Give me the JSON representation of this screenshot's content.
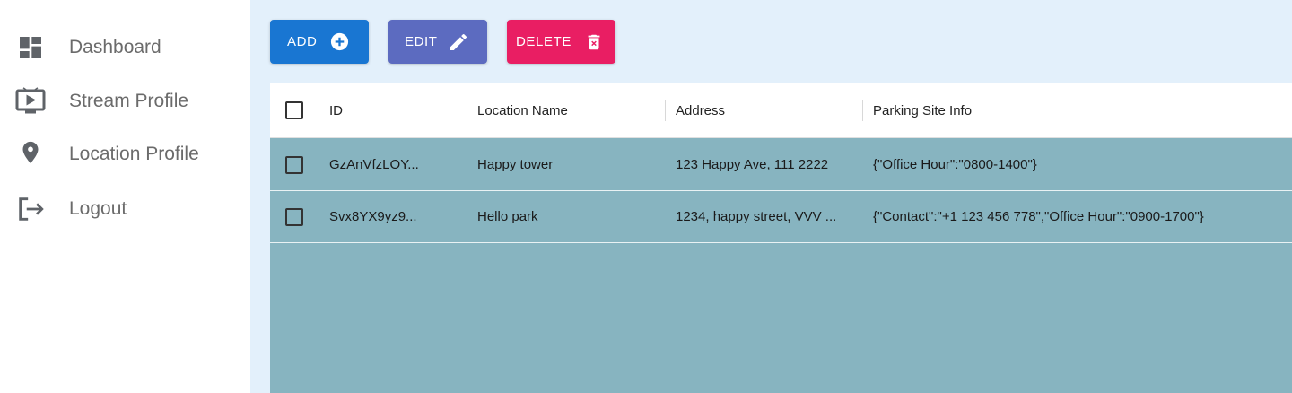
{
  "sidebar": {
    "items": [
      {
        "label": "Dashboard",
        "icon": "dashboard-icon"
      },
      {
        "label": "Stream Profile",
        "icon": "tv-icon"
      },
      {
        "label": "Location Profile",
        "icon": "location-pin-icon"
      },
      {
        "label": "Logout",
        "icon": "logout-icon"
      }
    ]
  },
  "toolbar": {
    "add_label": "ADD",
    "edit_label": "EDIT",
    "delete_label": "DELETE"
  },
  "table": {
    "columns": [
      "ID",
      "Location Name",
      "Address",
      "Parking Site Info"
    ],
    "rows": [
      {
        "id": "GzAnVfzLOY...",
        "location_name": "Happy tower",
        "address": "123 Happy Ave, 111 2222",
        "info": "{\"Office Hour\":\"0800-1400\"}"
      },
      {
        "id": "Svx8YX9yz9...",
        "location_name": "Hello park",
        "address": "1234, happy street, VVV ...",
        "info": "{\"Contact\":\"+1 123 456 778\",\"Office Hour\":\"0900-1700\"}"
      }
    ]
  },
  "colors": {
    "add": "#1976d2",
    "edit": "#5c6bc0",
    "delete": "#e91e63",
    "main_bg": "#e3f0fb",
    "grid_bg": "#87b4c0"
  }
}
